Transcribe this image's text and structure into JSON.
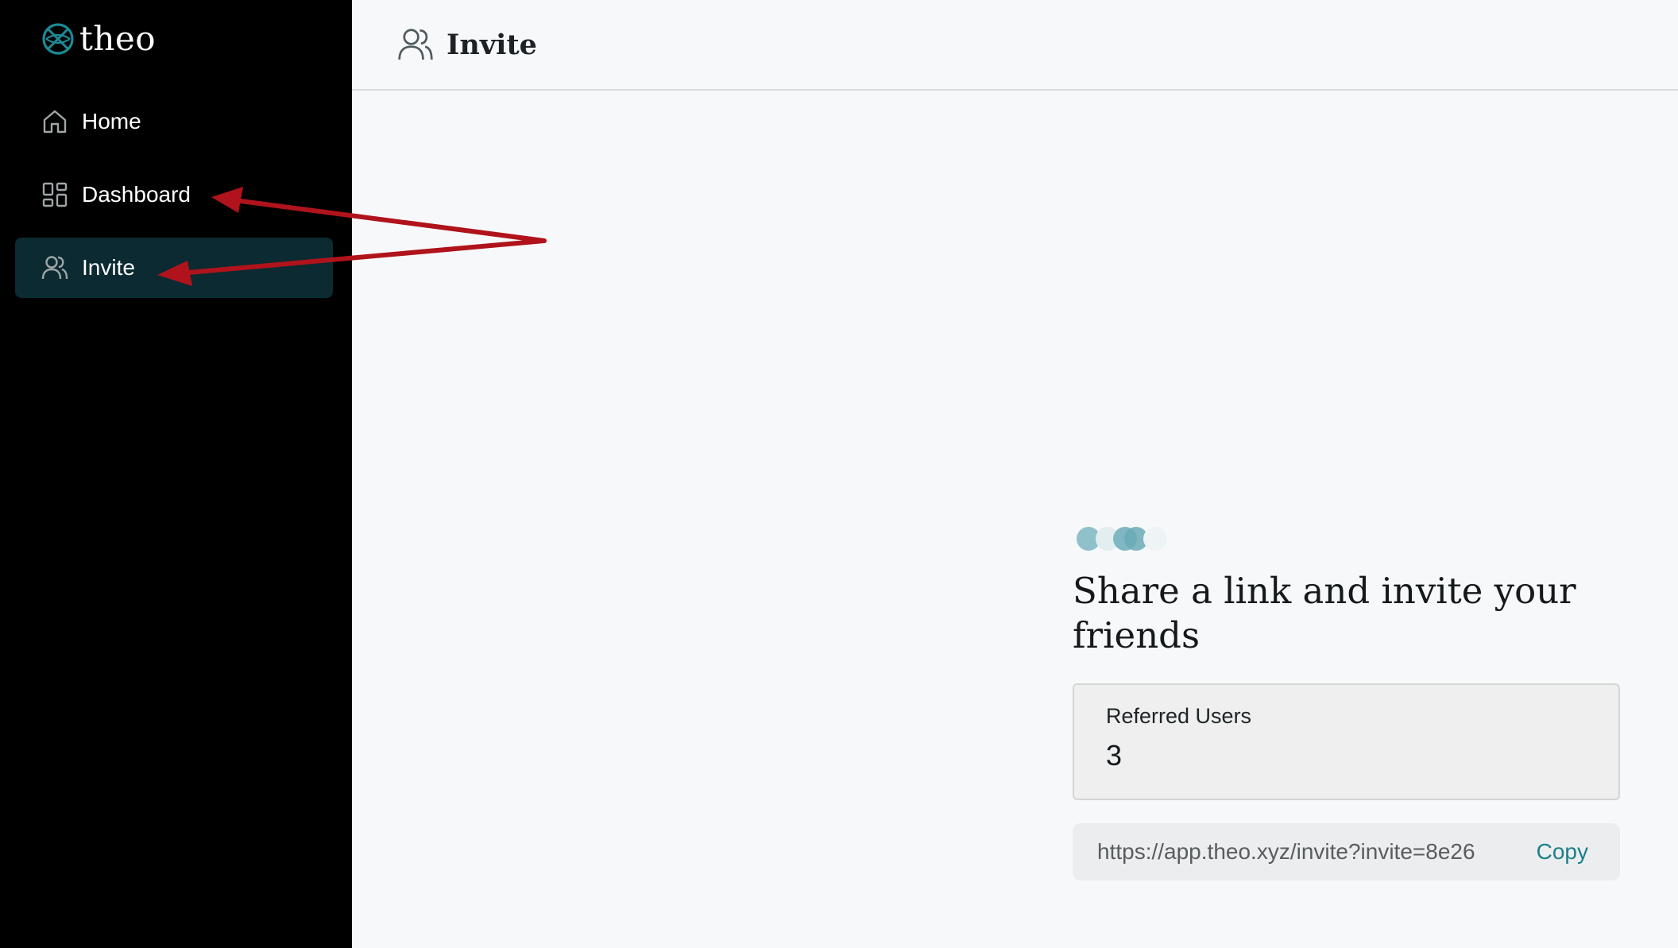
{
  "brand": {
    "name": "theo",
    "logo_icon": "globe-logo-icon",
    "accent": "#1c8a96"
  },
  "sidebar": {
    "items": [
      {
        "label": "Home",
        "icon": "home-icon",
        "active": false
      },
      {
        "label": "Dashboard",
        "icon": "grid-icon",
        "active": false
      },
      {
        "label": "Invite",
        "icon": "users-icon",
        "active": true
      }
    ]
  },
  "header": {
    "title": "Invite",
    "icon": "users-icon"
  },
  "invite": {
    "headline": "Share a link and invite your friends",
    "referred_users_label": "Referred Users",
    "referred_users_count": "3",
    "invite_link": "https://app.theo.xyz/invite?invite=8e26",
    "copy_label": "Copy"
  },
  "colors": {
    "sidebar_bg": "#000000",
    "active_item_bg": "#0b2a31",
    "accent": "#1c7f8a",
    "annotation_arrow": "#b0131b"
  }
}
